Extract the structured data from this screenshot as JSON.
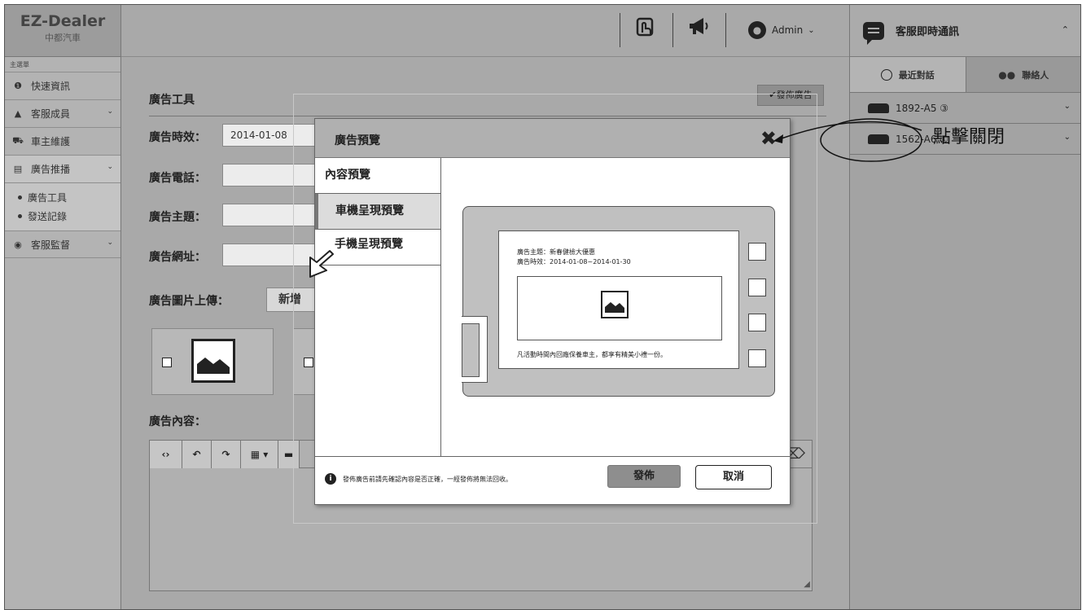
{
  "brand": {
    "name": "EZ-Dealer",
    "sub": "中都汽車"
  },
  "sidebar": {
    "menu_title": "主選單",
    "items": [
      {
        "label": "快速資訊",
        "icon": "info-icon",
        "glyph": "❶"
      },
      {
        "label": "客服成員",
        "icon": "user-icon",
        "glyph": "▲"
      },
      {
        "label": "車主維護",
        "icon": "car-icon",
        "glyph": "⛟"
      },
      {
        "label": "廣告推播",
        "icon": "ad-icon",
        "glyph": "▤"
      },
      {
        "label": "客服監督",
        "icon": "eye-icon",
        "glyph": "◉"
      }
    ],
    "sub_items": [
      {
        "label": "廣告工具"
      },
      {
        "label": "發送記錄"
      }
    ]
  },
  "topbar": {
    "user": "Admin"
  },
  "main": {
    "title": "廣告工具",
    "publish_label": "✔發佈廣告",
    "fields": {
      "time_label": "廣告時效：",
      "time_value": "2014-01-08",
      "phone_label": "廣告電話：",
      "topic_label": "廣告主題：",
      "url_label": "廣告網址：",
      "upload_label": "廣告圖片上傳：",
      "add_label": "新增",
      "content_label": "廣告內容："
    }
  },
  "chat": {
    "title": "客服即時通訊",
    "tabs": [
      {
        "label": "最近對話",
        "icon": "clock-icon"
      },
      {
        "label": "聯絡人",
        "icon": "contacts-icon"
      }
    ],
    "rows": [
      {
        "label": "1892-A5 ③"
      },
      {
        "label": "1562-A6 ①"
      }
    ]
  },
  "modal": {
    "title": "廣告預覽",
    "tabs": [
      {
        "label": "內容預覽"
      },
      {
        "label": "車機呈現預覽"
      },
      {
        "label": "手機呈現預覽"
      }
    ],
    "selected_tab": 1,
    "preview": {
      "topic": "廣告主題：新春健檢大優惠",
      "period": "廣告時效：2014-01-08~2014-01-30",
      "note": "凡活動時間內回廠保養車主，都享有精美小禮一份。"
    },
    "footer_note": "發佈廣告前請先確認內容是否正確，一經發佈將無法回收。",
    "publish": "發佈",
    "cancel": "取消"
  },
  "annotation": {
    "text": "點擊關閉"
  }
}
